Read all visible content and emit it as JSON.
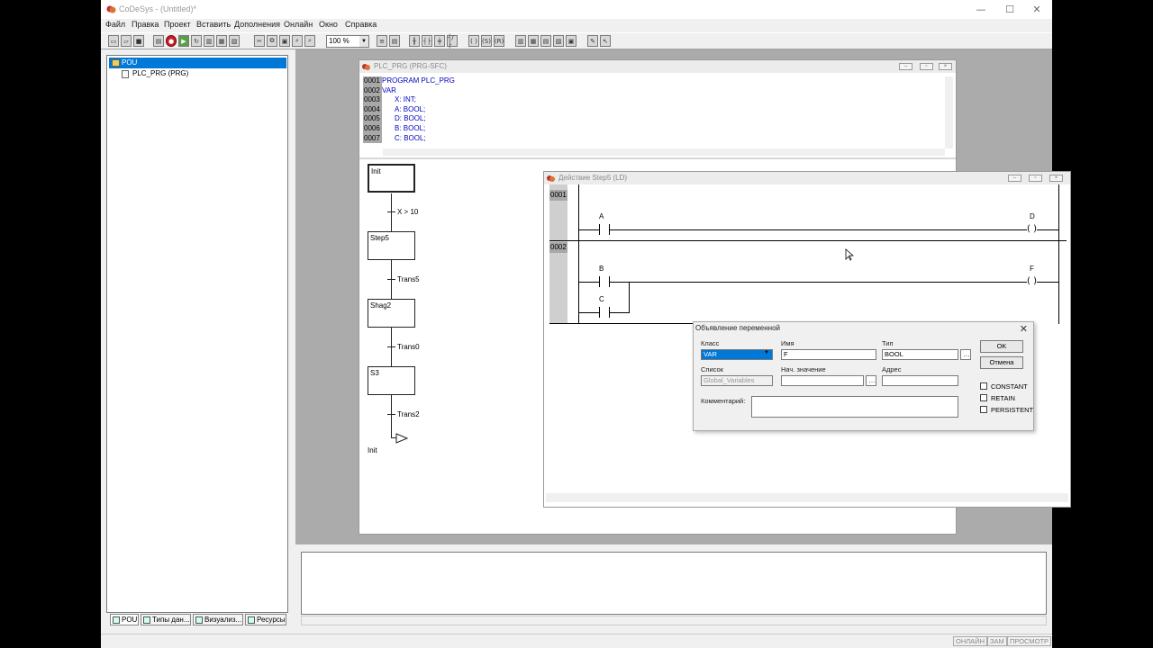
{
  "app": {
    "title": "CoDeSys - (Untitled)*"
  },
  "window_controls": {
    "minimize": "—",
    "maximize": "☐",
    "close": "✕"
  },
  "menu": [
    "Файл",
    "Правка",
    "Проект",
    "Вставить",
    "Дополнения",
    "Онлайн",
    "Окно",
    "Справка"
  ],
  "toolbar": {
    "zoom": "100 %"
  },
  "tree": {
    "root": "POU",
    "child": "PLC_PRG (PRG)"
  },
  "left_tabs": [
    "POU",
    "Типы дан...",
    "Визуализ...",
    "Ресурсы"
  ],
  "sfc_window": {
    "title": "PLC_PRG (PRG-SFC)",
    "lines": [
      {
        "n": "0001",
        "text": "PROGRAM PLC_PRG"
      },
      {
        "n": "0002",
        "text": "VAR"
      },
      {
        "n": "0003",
        "text": "X: INT;"
      },
      {
        "n": "0004",
        "text": "A: BOOL;"
      },
      {
        "n": "0005",
        "text": "D: BOOL;"
      },
      {
        "n": "0006",
        "text": "B: BOOL;"
      },
      {
        "n": "0007",
        "text": "C: BOOL;"
      }
    ],
    "steps": [
      "Init",
      "Step5",
      "Shag2",
      "S3"
    ],
    "transitions": [
      "X > 10",
      "Trans5",
      "Trans0",
      "Trans2"
    ],
    "jump": "Init"
  },
  "ld_window": {
    "title": "Действие Step5 (LD)",
    "networks": [
      "0001",
      "0002"
    ],
    "vars": {
      "a": "A",
      "d": "D",
      "b": "B",
      "c": "C",
      "f": "F"
    },
    "coil": "( )"
  },
  "dialog": {
    "title": "Объявление переменной",
    "class_label": "Класс",
    "class_value": "VAR",
    "name_label": "Имя",
    "name_value": "F",
    "type_label": "Тип",
    "type_value": "BOOL",
    "list_label": "Список",
    "list_value": "Global_Variables",
    "init_label": "Нач. значение",
    "address_label": "Адрес",
    "comment_label": "Комментарий:",
    "ok": "OK",
    "cancel": "Отмена",
    "checks": [
      "CONSTANT",
      "RETAIN",
      "PERSISTENT"
    ]
  },
  "status": [
    "ОНЛАЙН",
    "ЗАМ",
    "ПРОСМОТР"
  ]
}
